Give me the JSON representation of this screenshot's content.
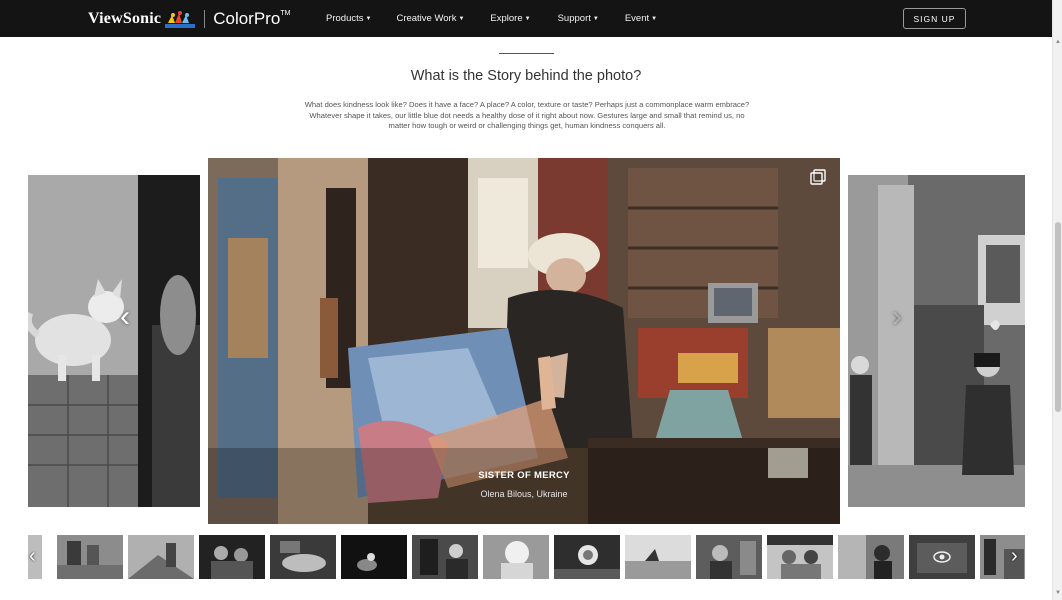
{
  "nav": {
    "brand": "ViewSonic",
    "product": "ColorPro",
    "trademark": "TM",
    "menu": [
      {
        "label": "Products",
        "name": "menu-products"
      },
      {
        "label": "Creative Work",
        "name": "menu-creative-work"
      },
      {
        "label": "Explore",
        "name": "menu-explore"
      },
      {
        "label": "Support",
        "name": "menu-support"
      },
      {
        "label": "Event",
        "name": "menu-event"
      }
    ],
    "signup_label": "SIGN UP"
  },
  "section": {
    "title": "What is the Story behind the photo?",
    "body": "What does kindness look like? Does it have a face? A place? A color, texture or taste? Perhaps just a commonplace warm embrace? Whatever shape it takes, our little blue dot needs a healthy dose of it right about now. Gestures large and small that remind us, no matter how tough or weird or challenging things get, human kindness conquers all."
  },
  "carousel": {
    "caption_title": "SISTER OF MERCY",
    "caption_author": "Olena Bilous, Ukraine",
    "prev_icon": "chevron-left-icon",
    "next_icon": "chevron-right-icon",
    "gallery_icon": "copy-icon"
  },
  "thumbnails": {
    "count": 15,
    "view_icon": "eye-icon"
  },
  "colors": {
    "nav_bg": "#141414",
    "page_bg": "#ffffff",
    "text_dark": "#333333",
    "text_body": "#555555"
  }
}
